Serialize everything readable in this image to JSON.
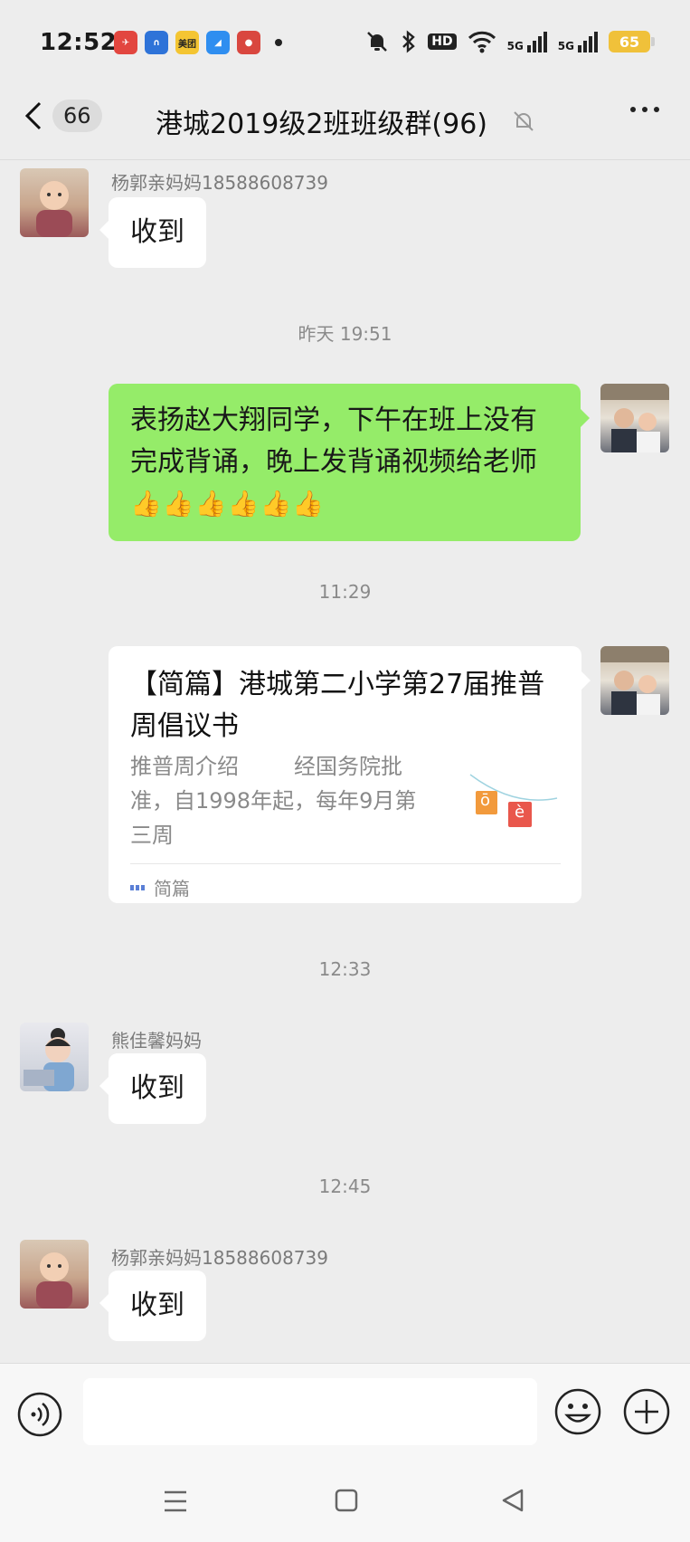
{
  "status_bar": {
    "time": "12:52",
    "app_icons": [
      "app-icon-1",
      "app-icon-2",
      "meituan-app-icon",
      "app-icon-4",
      "app-icon-5"
    ],
    "meituan_label": "美团",
    "hd_label": "HD",
    "signal_label": "5G",
    "battery": "65"
  },
  "title_bar": {
    "unread_count": "66",
    "title": "港城2019级2班班级群(96)"
  },
  "messages": {
    "m1": {
      "sender": "杨郭亲妈妈18588608739",
      "text": "收到"
    },
    "ts1": "昨天 19:51",
    "m2": {
      "text": "表扬赵大翔同学，下午在班上没有完成背诵，晚上发背诵视频给老师",
      "emoji": "👍👍👍👍👍👍"
    },
    "ts2": "11:29",
    "m3": {
      "title": "【简篇】港城第二小学第27届推普周倡议书",
      "desc": "推普周介绍        经国务院批准，自1998年起，每年9月第三周",
      "thumb_letters": [
        "ō",
        "è"
      ],
      "source": "简篇"
    },
    "ts3": "12:33",
    "m4": {
      "sender": "熊佳馨妈妈",
      "text": "收到"
    },
    "ts4": "12:45",
    "m5": {
      "sender": "杨郭亲妈妈18588608739",
      "text": "收到"
    }
  },
  "input": {
    "placeholder": ""
  },
  "colors": {
    "background": "#ededed",
    "outgoing_bubble": "#95ec69",
    "incoming_bubble": "#ffffff"
  }
}
